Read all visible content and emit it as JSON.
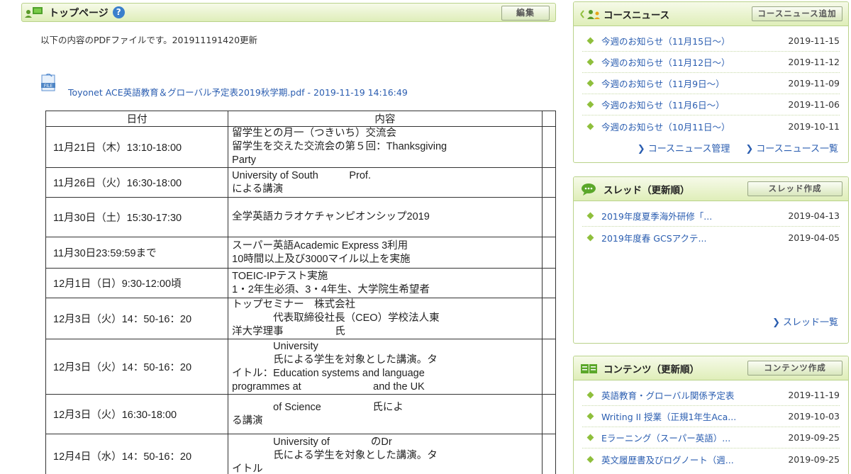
{
  "main": {
    "title": "トップページ",
    "help": "?",
    "edit_label": "編集",
    "description": "以下の内容のPDFファイルです。201911191420更新",
    "file_icon_text": "FILE",
    "file_link": "Toyonet ACE英語教育＆グローバル予定表2019秋学期.pdf - 2019-11-19 14:16:49",
    "table": {
      "headers": [
        "日付",
        "内容"
      ],
      "rows": [
        {
          "date": "11月21日（木）13:10-18:00",
          "content": [
            "留学生との月一（つきいち）交流会",
            "留学生を交えた交流会の第５回：Thanksgiving",
            "Party"
          ]
        },
        {
          "date": "11月26日（火）16:30-18:00",
          "content": [
            "University of South　　　Prof.",
            "による講演"
          ]
        },
        {
          "date": "11月30日（土）15:30-17:30",
          "content": [
            "全学英語カラオケチャンピオンシップ2019"
          ]
        },
        {
          "date": "11月30日23:59:59まで",
          "content": [
            "スーパー英語Academic Express 3利用",
            "10時間以上及び3000マイル以上を実施"
          ]
        },
        {
          "date": "12月1日（日）9:30-12:00頃",
          "content": [
            "TOEIC-IPテスト実施",
            "1・2年生必須、3・4年生、大学院生希望者"
          ]
        },
        {
          "date": "12月3日（火）14：50-16：20",
          "content": [
            "トップセミナー　株式会社",
            "　　　　代表取締役社長（CEO）学校法人東",
            "洋大学理事　　　　　氏"
          ]
        },
        {
          "date": "12月3日（火）14：50-16：20",
          "content": [
            "　　　　University",
            "　　　　氏による学生を対象とした講演。タ",
            "イトル：Education systems and language",
            "programmes at　　　　　　　and the UK"
          ]
        },
        {
          "date": "12月3日（火）16:30-18:00",
          "content": [
            "　　　　of Science　　　　　氏によ",
            "る講演"
          ]
        },
        {
          "date": "12月4日（水）14：50-16：20",
          "content": [
            "　　　　University of　　　　のDr",
            "　　　　氏による学生を対象とした講演。タ",
            "イトル"
          ]
        }
      ]
    }
  },
  "course_news": {
    "title": "コースニュース",
    "add_label": "コースニュース追加",
    "items": [
      {
        "label": "今週のお知らせ（11月15日～）",
        "date": "2019-11-15"
      },
      {
        "label": "今週のお知らせ（11月12日～）",
        "date": "2019-11-12"
      },
      {
        "label": "今週のお知らせ（11月9日～）",
        "date": "2019-11-09"
      },
      {
        "label": "今週のお知らせ（11月6日～）",
        "date": "2019-11-06"
      },
      {
        "label": "今週のお知らせ（10月11日～）",
        "date": "2019-10-11"
      }
    ],
    "manage_label": "コースニュース管理",
    "list_label": "コースニュース一覧"
  },
  "threads": {
    "title": "スレッド（更新順）",
    "create_label": "スレッド作成",
    "items": [
      {
        "label": "2019年度夏季海外研修「...",
        "date": "2019-04-13"
      },
      {
        "label": "2019年度春 GCSアクテ...",
        "date": "2019-04-05"
      }
    ],
    "list_label": "スレッド一覧"
  },
  "contents": {
    "title": "コンテンツ（更新順）",
    "create_label": "コンテンツ作成",
    "items": [
      {
        "label": "英語教育・グローバル関係予定表",
        "date": "2019-11-19"
      },
      {
        "label": "Writing II 授業（正規1年生Aca...",
        "date": "2019-10-03"
      },
      {
        "label": "Eラーニング（スーパー英語）...",
        "date": "2019-09-25"
      },
      {
        "label": "英文履歴書及びログノート（週...",
        "date": "2019-09-25"
      }
    ]
  },
  "colors": {
    "accent_green": "#8fbf3c",
    "link_blue": "#2a5db0",
    "header_border": "#b9d28a"
  }
}
